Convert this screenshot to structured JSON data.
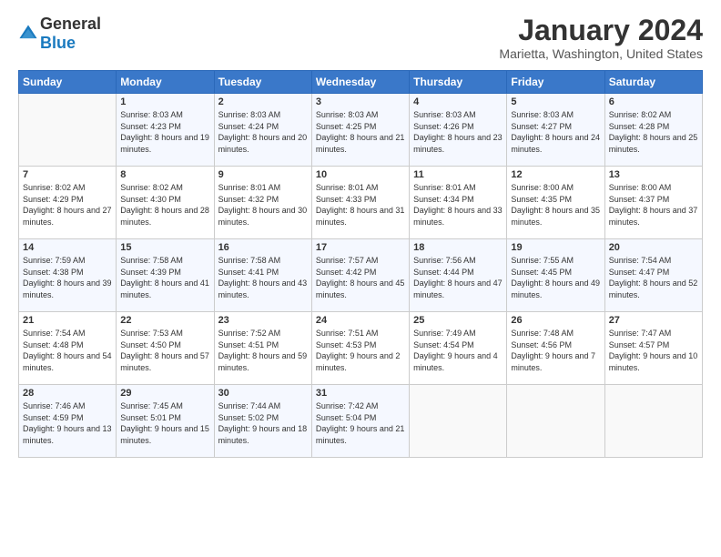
{
  "header": {
    "logo": {
      "general": "General",
      "blue": "Blue"
    },
    "title": "January 2024",
    "location": "Marietta, Washington, United States"
  },
  "weekdays": [
    "Sunday",
    "Monday",
    "Tuesday",
    "Wednesday",
    "Thursday",
    "Friday",
    "Saturday"
  ],
  "weeks": [
    [
      {
        "day": "",
        "sunrise": "",
        "sunset": "",
        "daylight": ""
      },
      {
        "day": "1",
        "sunrise": "8:03 AM",
        "sunset": "4:23 PM",
        "daylight": "8 hours and 19 minutes."
      },
      {
        "day": "2",
        "sunrise": "8:03 AM",
        "sunset": "4:24 PM",
        "daylight": "8 hours and 20 minutes."
      },
      {
        "day": "3",
        "sunrise": "8:03 AM",
        "sunset": "4:25 PM",
        "daylight": "8 hours and 21 minutes."
      },
      {
        "day": "4",
        "sunrise": "8:03 AM",
        "sunset": "4:26 PM",
        "daylight": "8 hours and 23 minutes."
      },
      {
        "day": "5",
        "sunrise": "8:03 AM",
        "sunset": "4:27 PM",
        "daylight": "8 hours and 24 minutes."
      },
      {
        "day": "6",
        "sunrise": "8:02 AM",
        "sunset": "4:28 PM",
        "daylight": "8 hours and 25 minutes."
      }
    ],
    [
      {
        "day": "7",
        "sunrise": "8:02 AM",
        "sunset": "4:29 PM",
        "daylight": "8 hours and 27 minutes."
      },
      {
        "day": "8",
        "sunrise": "8:02 AM",
        "sunset": "4:30 PM",
        "daylight": "8 hours and 28 minutes."
      },
      {
        "day": "9",
        "sunrise": "8:01 AM",
        "sunset": "4:32 PM",
        "daylight": "8 hours and 30 minutes."
      },
      {
        "day": "10",
        "sunrise": "8:01 AM",
        "sunset": "4:33 PM",
        "daylight": "8 hours and 31 minutes."
      },
      {
        "day": "11",
        "sunrise": "8:01 AM",
        "sunset": "4:34 PM",
        "daylight": "8 hours and 33 minutes."
      },
      {
        "day": "12",
        "sunrise": "8:00 AM",
        "sunset": "4:35 PM",
        "daylight": "8 hours and 35 minutes."
      },
      {
        "day": "13",
        "sunrise": "8:00 AM",
        "sunset": "4:37 PM",
        "daylight": "8 hours and 37 minutes."
      }
    ],
    [
      {
        "day": "14",
        "sunrise": "7:59 AM",
        "sunset": "4:38 PM",
        "daylight": "8 hours and 39 minutes."
      },
      {
        "day": "15",
        "sunrise": "7:58 AM",
        "sunset": "4:39 PM",
        "daylight": "8 hours and 41 minutes."
      },
      {
        "day": "16",
        "sunrise": "7:58 AM",
        "sunset": "4:41 PM",
        "daylight": "8 hours and 43 minutes."
      },
      {
        "day": "17",
        "sunrise": "7:57 AM",
        "sunset": "4:42 PM",
        "daylight": "8 hours and 45 minutes."
      },
      {
        "day": "18",
        "sunrise": "7:56 AM",
        "sunset": "4:44 PM",
        "daylight": "8 hours and 47 minutes."
      },
      {
        "day": "19",
        "sunrise": "7:55 AM",
        "sunset": "4:45 PM",
        "daylight": "8 hours and 49 minutes."
      },
      {
        "day": "20",
        "sunrise": "7:54 AM",
        "sunset": "4:47 PM",
        "daylight": "8 hours and 52 minutes."
      }
    ],
    [
      {
        "day": "21",
        "sunrise": "7:54 AM",
        "sunset": "4:48 PM",
        "daylight": "8 hours and 54 minutes."
      },
      {
        "day": "22",
        "sunrise": "7:53 AM",
        "sunset": "4:50 PM",
        "daylight": "8 hours and 57 minutes."
      },
      {
        "day": "23",
        "sunrise": "7:52 AM",
        "sunset": "4:51 PM",
        "daylight": "8 hours and 59 minutes."
      },
      {
        "day": "24",
        "sunrise": "7:51 AM",
        "sunset": "4:53 PM",
        "daylight": "9 hours and 2 minutes."
      },
      {
        "day": "25",
        "sunrise": "7:49 AM",
        "sunset": "4:54 PM",
        "daylight": "9 hours and 4 minutes."
      },
      {
        "day": "26",
        "sunrise": "7:48 AM",
        "sunset": "4:56 PM",
        "daylight": "9 hours and 7 minutes."
      },
      {
        "day": "27",
        "sunrise": "7:47 AM",
        "sunset": "4:57 PM",
        "daylight": "9 hours and 10 minutes."
      }
    ],
    [
      {
        "day": "28",
        "sunrise": "7:46 AM",
        "sunset": "4:59 PM",
        "daylight": "9 hours and 13 minutes."
      },
      {
        "day": "29",
        "sunrise": "7:45 AM",
        "sunset": "5:01 PM",
        "daylight": "9 hours and 15 minutes."
      },
      {
        "day": "30",
        "sunrise": "7:44 AM",
        "sunset": "5:02 PM",
        "daylight": "9 hours and 18 minutes."
      },
      {
        "day": "31",
        "sunrise": "7:42 AM",
        "sunset": "5:04 PM",
        "daylight": "9 hours and 21 minutes."
      },
      {
        "day": "",
        "sunrise": "",
        "sunset": "",
        "daylight": ""
      },
      {
        "day": "",
        "sunrise": "",
        "sunset": "",
        "daylight": ""
      },
      {
        "day": "",
        "sunrise": "",
        "sunset": "",
        "daylight": ""
      }
    ]
  ],
  "labels": {
    "sunrise_prefix": "Sunrise: ",
    "sunset_prefix": "Sunset: ",
    "daylight_prefix": "Daylight: "
  }
}
